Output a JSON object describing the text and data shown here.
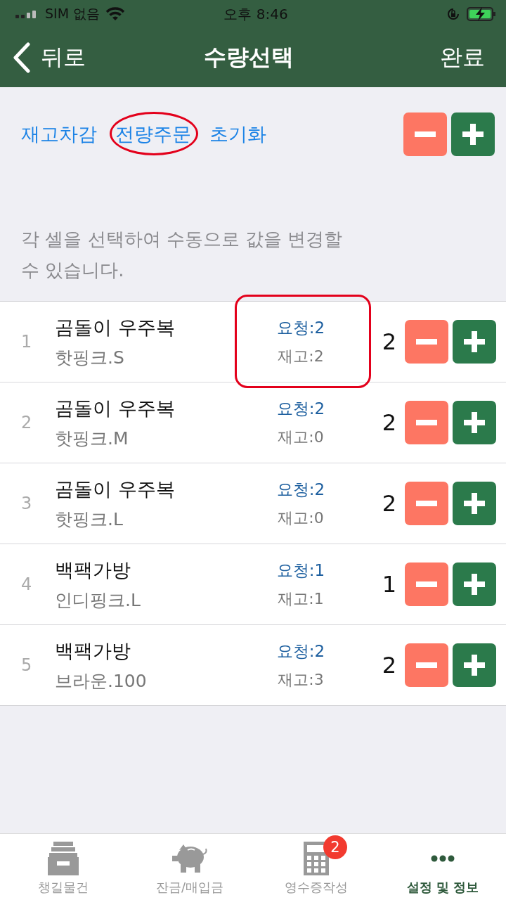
{
  "status_bar": {
    "carrier": "SIM 없음",
    "time": "오후 8:46"
  },
  "nav": {
    "back": "뒤로",
    "title": "수량선택",
    "done": "완료"
  },
  "actions": [
    {
      "label": "재고차감",
      "circled": false
    },
    {
      "label": "전량주문",
      "circled": true
    },
    {
      "label": "초기화",
      "circled": false
    }
  ],
  "help": "각 셀을 선택하여 수동으로 값을 변경할 수 있습니다.",
  "rows": [
    {
      "index": "1",
      "name": "곰돌이 우주복",
      "option": "핫핑크.S",
      "request": "요청:2",
      "stock": "재고:2",
      "qty": "2",
      "boxed": true
    },
    {
      "index": "2",
      "name": "곰돌이 우주복",
      "option": "핫핑크.M",
      "request": "요청:2",
      "stock": "재고:0",
      "qty": "2",
      "boxed": false
    },
    {
      "index": "3",
      "name": "곰돌이 우주복",
      "option": "핫핑크.L",
      "request": "요청:2",
      "stock": "재고:0",
      "qty": "2",
      "boxed": false
    },
    {
      "index": "4",
      "name": "백팩가방",
      "option": "인디핑크.L",
      "request": "요청:1",
      "stock": "재고:1",
      "qty": "1",
      "boxed": false
    },
    {
      "index": "5",
      "name": "백팩가방",
      "option": "브라운.100",
      "request": "요청:2",
      "stock": "재고:3",
      "qty": "2",
      "boxed": false
    }
  ],
  "tabs": [
    {
      "kind": "archive",
      "label": "챙길물건",
      "selected": false
    },
    {
      "kind": "piggy",
      "label": "잔금/매입금",
      "selected": false
    },
    {
      "kind": "calculator",
      "label": "영수증작성",
      "selected": false,
      "badge": "2"
    },
    {
      "kind": "more",
      "label": "설정 및 정보",
      "selected": true
    }
  ]
}
